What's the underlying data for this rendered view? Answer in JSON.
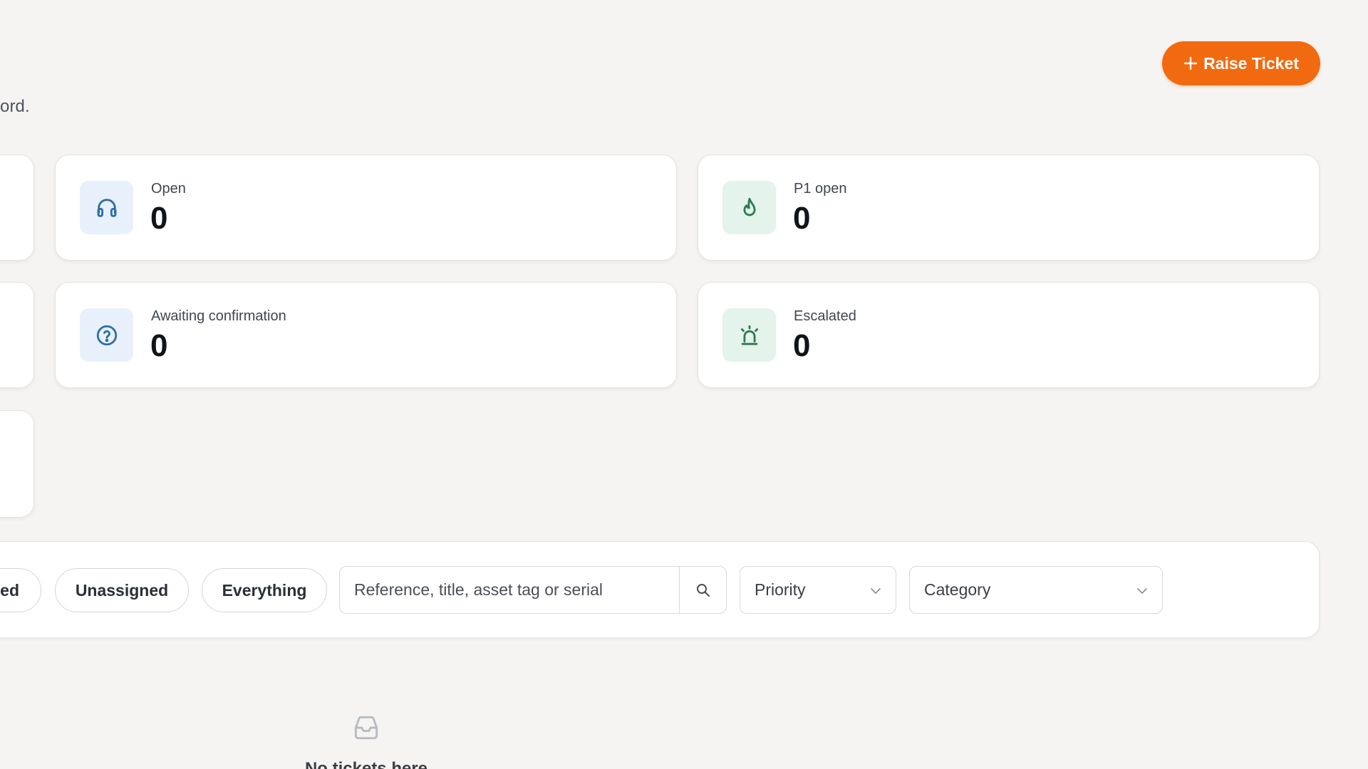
{
  "header": {
    "subtitle_fragment": "ord.",
    "raise_ticket_label": "Raise Ticket"
  },
  "stats": {
    "open": {
      "label": "Open",
      "value": "0",
      "icon": "headphones-icon"
    },
    "p1_open": {
      "label": "P1 open",
      "value": "0",
      "icon": "flame-icon"
    },
    "awaiting": {
      "label": "Awaiting confirmation",
      "value": "0",
      "icon": "question-circle-icon"
    },
    "escalated": {
      "label": "Escalated",
      "value": "0",
      "icon": "siren-icon"
    }
  },
  "filters": {
    "chip_partial_label": "ed",
    "chips": [
      "Unassigned",
      "Everything"
    ],
    "search_placeholder": "Reference, title, asset tag or serial",
    "priority_label": "Priority",
    "category_label": "Category"
  },
  "empty": {
    "title": "No tickets here",
    "icon": "inbox-icon"
  },
  "colors": {
    "accent": "#f26a0f",
    "background": "#f5f4f2",
    "icon_blue_bg": "#e8f1fb",
    "icon_green_bg": "#e4f3ec"
  }
}
